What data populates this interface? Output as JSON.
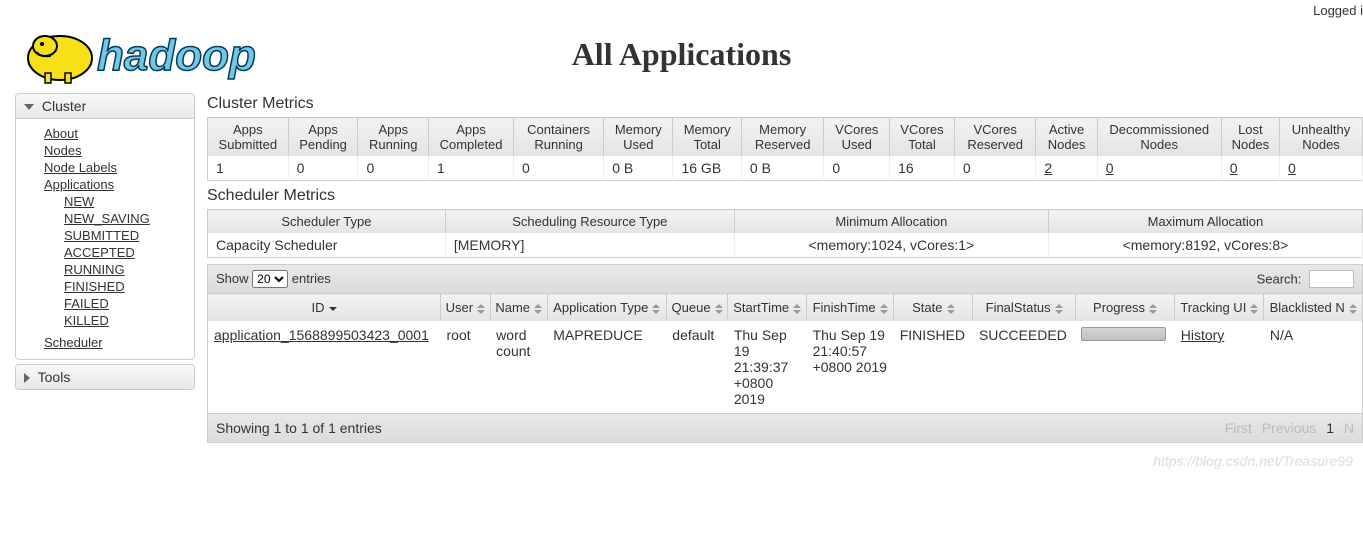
{
  "topbar": {
    "logged_in": "Logged i"
  },
  "page_title": "All Applications",
  "sidebar": {
    "cluster_label": "Cluster",
    "tools_label": "Tools",
    "links": {
      "about": "About",
      "nodes": "Nodes",
      "node_labels": "Node Labels",
      "applications": "Applications",
      "scheduler": "Scheduler"
    },
    "app_states": [
      "NEW",
      "NEW_SAVING",
      "SUBMITTED",
      "ACCEPTED",
      "RUNNING",
      "FINISHED",
      "FAILED",
      "KILLED"
    ]
  },
  "cluster_metrics": {
    "title": "Cluster Metrics",
    "headers": [
      "Apps Submitted",
      "Apps Pending",
      "Apps Running",
      "Apps Completed",
      "Containers Running",
      "Memory Used",
      "Memory Total",
      "Memory Reserved",
      "VCores Used",
      "VCores Total",
      "VCores Reserved",
      "Active Nodes",
      "Decommissioned Nodes",
      "Lost Nodes",
      "Unhealthy Nodes"
    ],
    "values": [
      "1",
      "0",
      "0",
      "1",
      "0",
      "0 B",
      "16 GB",
      "0 B",
      "0",
      "16",
      "0",
      "2",
      "0",
      "0",
      "0"
    ],
    "links": [
      false,
      false,
      false,
      false,
      false,
      false,
      false,
      false,
      false,
      false,
      false,
      true,
      true,
      true,
      true
    ]
  },
  "scheduler_metrics": {
    "title": "Scheduler Metrics",
    "headers": [
      "Scheduler Type",
      "Scheduling Resource Type",
      "Minimum Allocation",
      "Maximum Allocation"
    ],
    "values": [
      "Capacity Scheduler",
      "[MEMORY]",
      "<memory:1024, vCores:1>",
      "<memory:8192, vCores:8>"
    ]
  },
  "table_controls": {
    "show": "Show",
    "entries": "entries",
    "page_size": "20",
    "search": "Search:"
  },
  "apps_table": {
    "headers": [
      "ID",
      "User",
      "Name",
      "Application Type",
      "Queue",
      "StartTime",
      "FinishTime",
      "State",
      "FinalStatus",
      "Progress",
      "Tracking UI",
      "Blacklisted N"
    ],
    "row": {
      "id": "application_1568899503423_0001",
      "user": "root",
      "name": "word count",
      "type": "MAPREDUCE",
      "queue": "default",
      "start": "Thu Sep 19 21:39:37 +0800 2019",
      "finish": "Thu Sep 19 21:40:57 +0800 2019",
      "state": "FINISHED",
      "final": "SUCCEEDED",
      "tracking": "History",
      "blacklisted": "N/A"
    }
  },
  "footer": {
    "info": "Showing 1 to 1 of 1 entries",
    "first": "First",
    "prev": "Previous",
    "page": "1",
    "next": "N"
  },
  "watermark": "https://blog.csdn.net/Treasure99"
}
